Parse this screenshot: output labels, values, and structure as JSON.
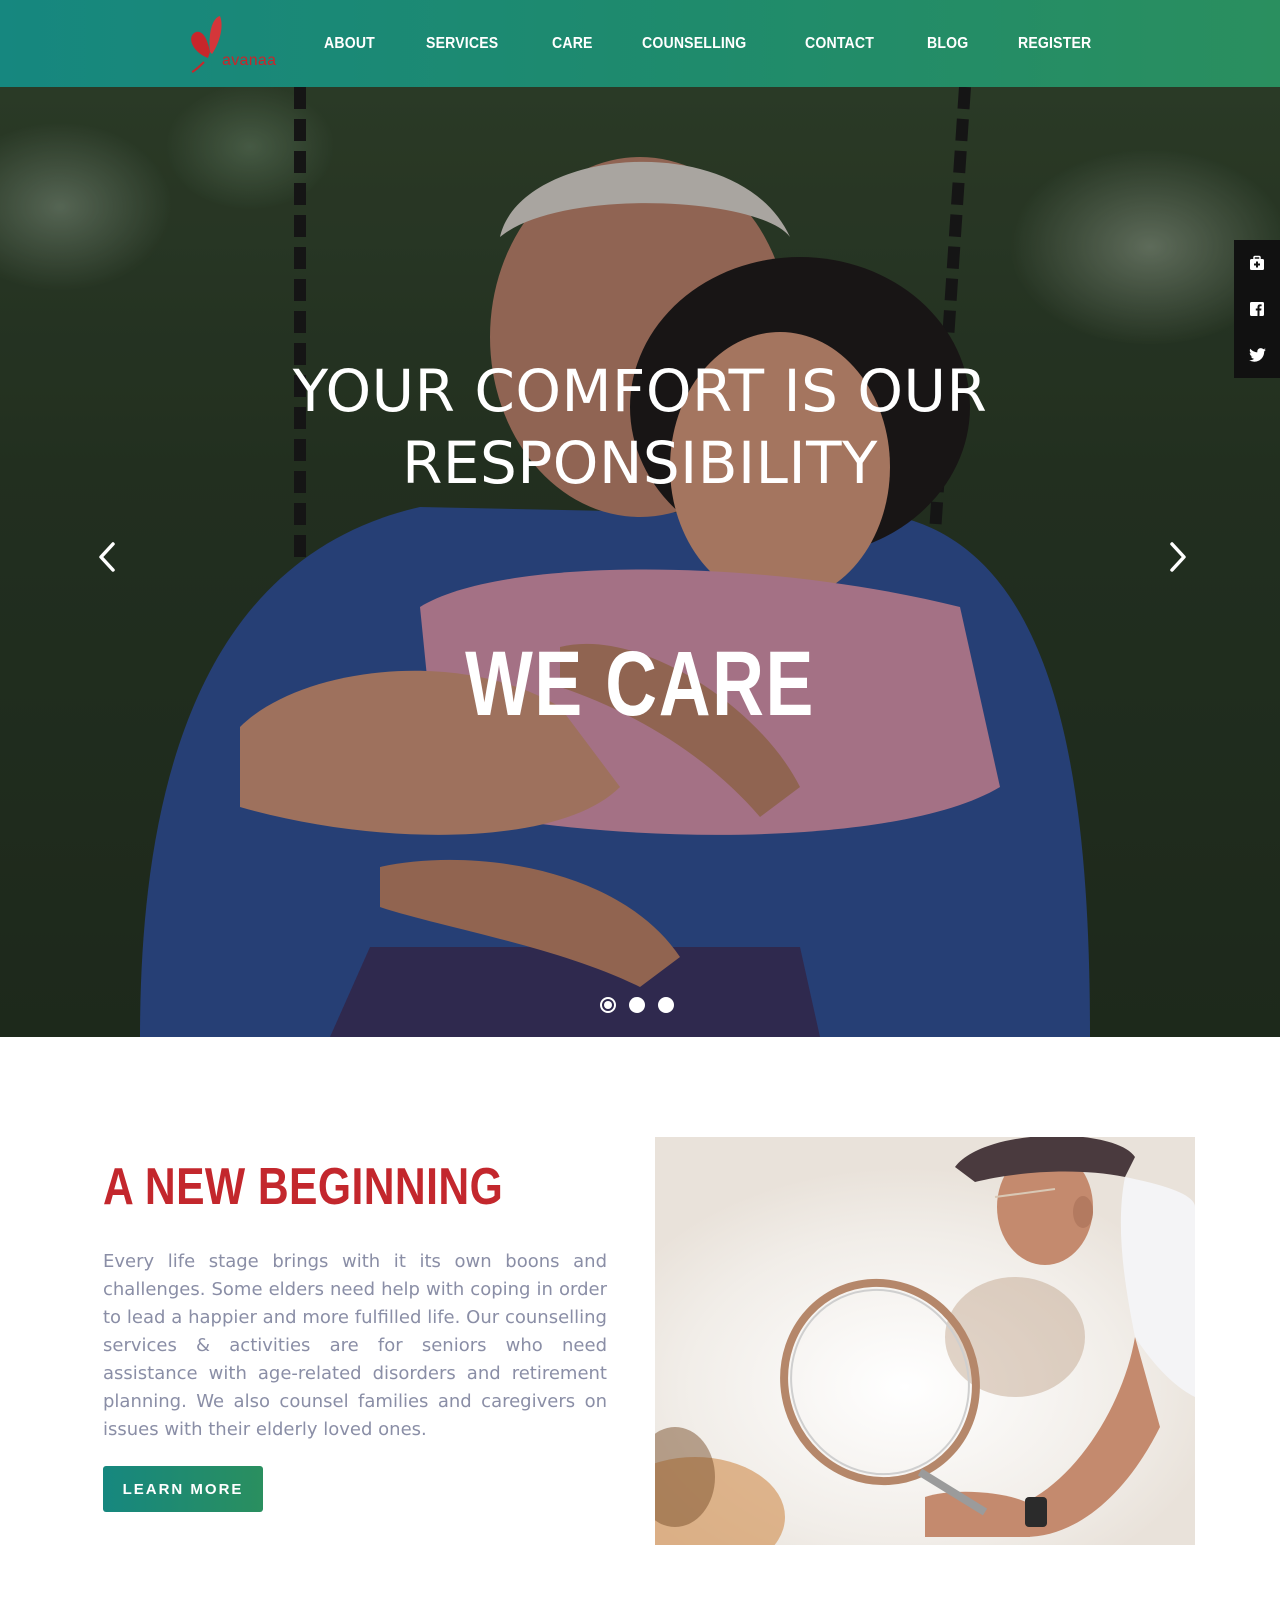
{
  "brand": {
    "name": "avanaa",
    "accent": "#c3272d",
    "gradient_start": "#16877f",
    "gradient_end": "#2a8f5f"
  },
  "nav": {
    "items": [
      {
        "label": "ABOUT"
      },
      {
        "label": "SERVICES"
      },
      {
        "label": "CARE"
      },
      {
        "label": "COUNSELLING"
      },
      {
        "label": "CONTACT"
      },
      {
        "label": "BLOG"
      },
      {
        "label": "REGISTER"
      }
    ]
  },
  "hero": {
    "title_line1": "YOUR COMFORT IS OUR",
    "title_line2": "RESPONSIBILITY",
    "subtitle": "WE CARE",
    "prev_icon": "chevron-left-icon",
    "next_icon": "chevron-right-icon",
    "slides": 3,
    "active_slide": 1
  },
  "social": {
    "items": [
      {
        "icon": "medical-kit-icon"
      },
      {
        "icon": "facebook-icon"
      },
      {
        "icon": "twitter-icon"
      }
    ]
  },
  "about": {
    "title": "A NEW BEGINNING",
    "text": "Every life stage brings with it its own boons and challenges. Some elders need help with coping in order to lead a happier and more fulfilled life. Our counselling services & activities are for seniors who need assistance with age-related disorders and retirement planning. We also counsel families and caregivers on issues with their elderly loved ones.",
    "button_label": "LEARN MORE"
  }
}
